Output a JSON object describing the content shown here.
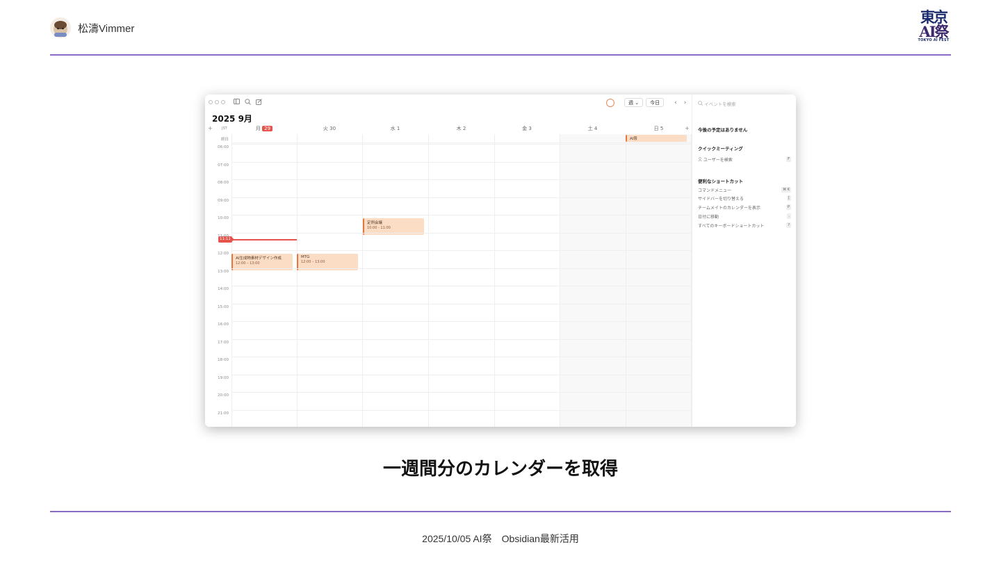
{
  "slide": {
    "author_name": "松濤Vimmer",
    "logo": {
      "line1": "東京",
      "line2": "AI祭",
      "sub": "TOKYO AI FEST"
    },
    "caption": "一週間分のカレンダーを取得",
    "footer": "2025/10/05 AI祭　Obsidian最新活用"
  },
  "colors": {
    "accent_rule": "#8a6cc8",
    "event_fill": "#fbdcc4",
    "event_border": "#e6763a",
    "now": "#e5534b"
  },
  "calendar": {
    "month_title": "2025 9月",
    "timezone_label": "JST",
    "plus_label": "+",
    "allday_label": "終日",
    "toolbar": {
      "view_label": "週 ⌄",
      "today_label": "今日",
      "prev": "‹",
      "next": "›"
    },
    "days": [
      {
        "label": "月",
        "date": "29",
        "today": true
      },
      {
        "label": "火 30"
      },
      {
        "label": "水 1"
      },
      {
        "label": "木 2"
      },
      {
        "label": "金 3"
      },
      {
        "label": "土 4"
      },
      {
        "label": "日 5"
      }
    ],
    "hours": [
      "06:00",
      "07:00",
      "08:00",
      "09:00",
      "10:00",
      "11:00",
      "12:00",
      "13:00",
      "14:00",
      "15:00",
      "16:00",
      "17:00",
      "18:00",
      "19:00",
      "20:00",
      "21:00"
    ],
    "now_label": "11:11",
    "events": [
      {
        "title": "定例会議",
        "time": "10:00 - 11:00"
      },
      {
        "title": "AI生成物素材デザイン作成",
        "time": "12:00 – 13:00"
      },
      {
        "title": "MTG",
        "time": "12:00 – 13:00"
      },
      {
        "title": "AI祭",
        "time": ""
      }
    ]
  },
  "sidebar": {
    "search_placeholder": "イベントを検索",
    "no_upcoming": "今後の予定はありません",
    "quick_meeting": "クイックミーティング",
    "user_search": "ユーザーを検索",
    "user_search_key": "F",
    "shortcuts_heading": "便利なショートカット",
    "shortcuts": [
      {
        "label": "コマンドメニュー",
        "keys": "⌘ K"
      },
      {
        "label": "サイドバーを切り替える",
        "keys": "["
      },
      {
        "label": "チームメイトのカレンダーを表示",
        "keys": "P"
      },
      {
        "label": "日付に移動",
        "keys": "."
      },
      {
        "label": "すべてのキーボードショートカット",
        "keys": "?"
      }
    ]
  }
}
